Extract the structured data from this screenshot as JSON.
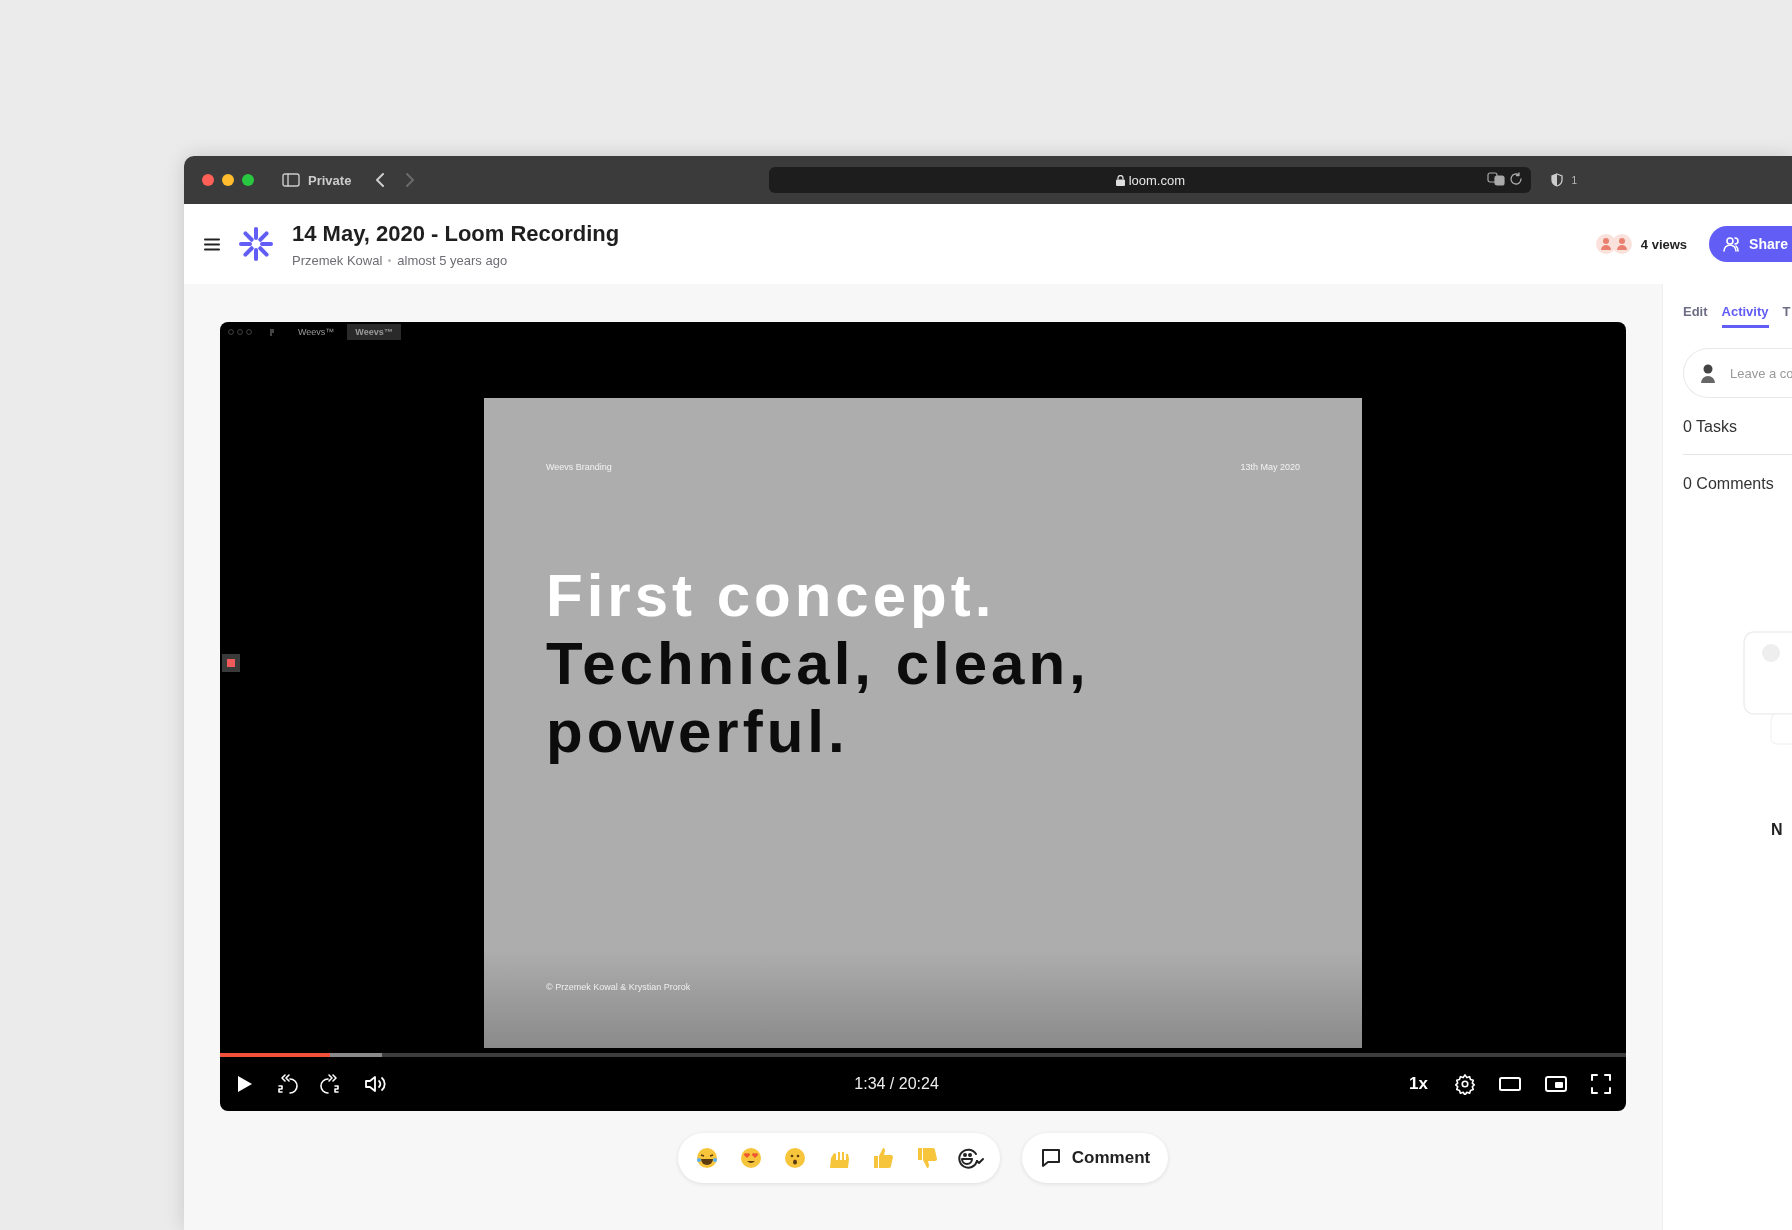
{
  "browser": {
    "mode": "Private",
    "back": {
      "disabled": false
    },
    "forward": {
      "disabled": true
    },
    "url": "loom.com",
    "shield_count": "1"
  },
  "header": {
    "title": "14 May, 2020 - Loom Recording",
    "author": "Przemek Kowal",
    "age": "almost 5 years ago",
    "views": "4 views",
    "share": "Share"
  },
  "video": {
    "recorded_tabs": [
      {
        "label": "Weevs™",
        "selected": false
      },
      {
        "label": "Weevs™",
        "selected": true
      }
    ],
    "slide": {
      "brand": "Weevs Branding",
      "date": "13th May 2020",
      "lines": [
        {
          "text": "First concept.",
          "kind": "light"
        },
        {
          "text": "Technical, clean,",
          "kind": "dark"
        },
        {
          "text": "powerful.",
          "kind": "dark"
        }
      ],
      "footer": "© Przemek Kowal & Krystian Prorok"
    },
    "progress": {
      "level": 0.078
    },
    "buffer": {
      "level": 0.115
    },
    "time": "1:34 / 20:24",
    "speed": "1x"
  },
  "reactions": [
    {
      "kind": "laugh"
    },
    {
      "kind": "love"
    },
    {
      "kind": "wow"
    },
    {
      "kind": "raise"
    },
    {
      "kind": "up"
    },
    {
      "kind": "down"
    },
    {
      "kind": "add"
    }
  ],
  "comment_button": "Comment",
  "panel": {
    "tabs": [
      {
        "label": "Edit",
        "selected": false
      },
      {
        "label": "Activity",
        "selected": true
      },
      {
        "label": "T",
        "selected": false
      }
    ],
    "comment_placeholder": "Leave a co",
    "tasks": "0 Tasks",
    "comments": "0 Comments",
    "fragment": "N"
  }
}
